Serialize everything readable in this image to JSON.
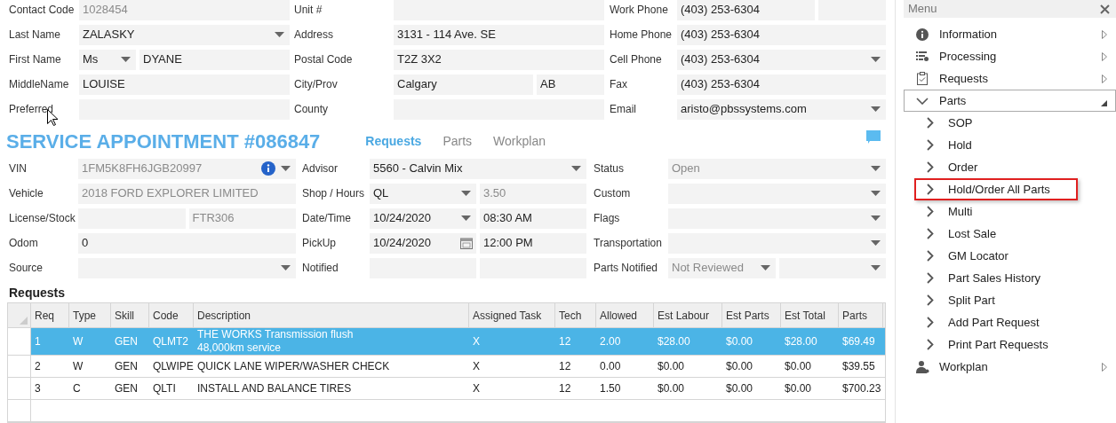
{
  "contact": {
    "columns": [
      [
        {
          "label": "Contact Code",
          "parts": [
            {
              "kind": "text",
              "value": "1028454",
              "readonly": true
            }
          ]
        },
        {
          "label": "Last Name",
          "parts": [
            {
              "kind": "dropdown",
              "value": "ZALASKY",
              "readonly": false
            }
          ]
        },
        {
          "label": "First Name",
          "parts": [
            {
              "kind": "dropdown",
              "value": "Ms",
              "readonly": false
            },
            {
              "kind": "text",
              "value": "DYANE",
              "readonly": false
            }
          ]
        },
        {
          "label": "MiddleName",
          "parts": [
            {
              "kind": "text",
              "value": "LOUISE",
              "readonly": false
            }
          ]
        },
        {
          "label": "Preferred",
          "parts": [
            {
              "kind": "text"
            }
          ]
        }
      ],
      [
        {
          "label": "Unit #",
          "parts": [
            {
              "kind": "text"
            }
          ]
        },
        {
          "label": "Address",
          "parts": [
            {
              "kind": "text",
              "value": "3131 - 114 Ave. SE",
              "readonly": false
            }
          ]
        },
        {
          "label": "Postal Code",
          "parts": [
            {
              "kind": "text",
              "value": "T2Z 3X2",
              "readonly": false
            }
          ]
        },
        {
          "label": "City/Prov",
          "parts": [
            {
              "kind": "text",
              "value": "Calgary",
              "readonly": false
            },
            {
              "kind": "text",
              "value": "AB",
              "readonly": false
            }
          ]
        },
        {
          "label": "County",
          "parts": [
            {
              "kind": "text"
            }
          ]
        }
      ],
      [
        {
          "label": "Work Phone",
          "parts": [
            {
              "kind": "text",
              "value": "(403) 253-6304",
              "readonly": false
            },
            {
              "kind": "text"
            }
          ]
        },
        {
          "label": "Home Phone",
          "parts": [
            {
              "kind": "text",
              "value": "(403) 253-6304",
              "readonly": false
            }
          ]
        },
        {
          "label": "Cell Phone",
          "parts": [
            {
              "kind": "dropdown",
              "value": "(403) 253-6304",
              "readonly": false
            }
          ]
        },
        {
          "label": "Fax",
          "parts": [
            {
              "kind": "text",
              "value": "(403) 253-6304",
              "readonly": false
            }
          ]
        },
        {
          "label": "Email",
          "parts": [
            {
              "kind": "dropdown",
              "value": "aristo@pbssystems.com",
              "readonly": false
            }
          ]
        }
      ]
    ]
  },
  "appointment": {
    "title": "SERVICE APPOINTMENT #086847",
    "tabs": [
      {
        "label": "Requests",
        "selected": true
      },
      {
        "label": "Parts",
        "selected": false
      },
      {
        "label": "Workplan",
        "selected": false
      }
    ],
    "columns": [
      [
        {
          "label": "VIN",
          "parts": [
            {
              "kind": "lookup",
              "value": "1FM5K8FH6JGB20997",
              "readonly": true
            }
          ]
        },
        {
          "label": "Vehicle",
          "parts": [
            {
              "kind": "text",
              "value": "2018 FORD EXPLORER LIMITED",
              "readonly": true
            }
          ]
        },
        {
          "label": "License/Stock",
          "parts": [
            {
              "kind": "text"
            },
            {
              "kind": "text",
              "value": "FTR306",
              "readonly": true
            }
          ]
        },
        {
          "label": "Odom",
          "parts": [
            {
              "kind": "text",
              "value": "0",
              "readonly": false
            }
          ]
        },
        {
          "label": "Source",
          "parts": [
            {
              "kind": "dropdown"
            }
          ]
        }
      ],
      [
        {
          "label": "Advisor",
          "parts": [
            {
              "kind": "dropdown",
              "value": "5560 - Calvin Mix",
              "readonly": false
            }
          ]
        },
        {
          "label": "Shop / Hours",
          "parts": [
            {
              "kind": "dropdown",
              "value": "QL",
              "readonly": false
            },
            {
              "kind": "text",
              "value": "3.50",
              "readonly": true
            }
          ]
        },
        {
          "label": "Date/Time",
          "parts": [
            {
              "kind": "dropdown",
              "value": "10/24/2020",
              "readonly": false
            },
            {
              "kind": "text",
              "value": "08:30 AM",
              "readonly": false
            }
          ]
        },
        {
          "label": "PickUp",
          "parts": [
            {
              "kind": "date",
              "value": "10/24/2020",
              "readonly": false
            },
            {
              "kind": "text",
              "value": "12:00 PM",
              "readonly": false
            }
          ]
        },
        {
          "label": "Notified",
          "parts": [
            {
              "kind": "text"
            },
            {
              "kind": "text"
            }
          ]
        }
      ],
      [
        {
          "label": "Status",
          "parts": [
            {
              "kind": "dropdown",
              "value": "Open",
              "readonly": true
            }
          ]
        },
        {
          "label": "Custom",
          "parts": [
            {
              "kind": "dropdown"
            }
          ]
        },
        {
          "label": "Flags",
          "parts": [
            {
              "kind": "dropdown"
            }
          ]
        },
        {
          "label": "Transportation",
          "parts": [
            {
              "kind": "dropdown"
            }
          ]
        },
        {
          "label": "Parts Notified",
          "parts": [
            {
              "kind": "dropdown",
              "value": "Not Reviewed",
              "readonly": true
            },
            {
              "kind": "dropdown"
            }
          ]
        }
      ]
    ]
  },
  "requests": {
    "title": "Requests",
    "columns": [
      "Req",
      "Type",
      "Skill",
      "Code",
      "Description",
      "Assigned Task",
      "Tech",
      "Allowed",
      "Est Labour",
      "Est Parts",
      "Est Total",
      "Parts"
    ],
    "rows": [
      {
        "selected": true,
        "cells": [
          "1",
          "W",
          "GEN",
          "QLMT2",
          "THE WORKS Transmission flush\n48,000km service",
          "X",
          "12",
          "2.00",
          "$28.00",
          "$0.00",
          "$28.00",
          "$69.49"
        ]
      },
      {
        "selected": false,
        "cells": [
          "2",
          "W",
          "GEN",
          "QLWIPE",
          "QUICK LANE WIPER/WASHER CHECK",
          "X",
          "12",
          "0.00",
          "$0.00",
          "$0.00",
          "$0.00",
          "$39.55"
        ]
      },
      {
        "selected": false,
        "cells": [
          "3",
          "C",
          "GEN",
          "QLTI",
          "INSTALL AND BALANCE TIRES",
          "X",
          "12",
          "1.50",
          "$0.00",
          "$0.00",
          "$0.00",
          "$700.23"
        ]
      }
    ]
  },
  "menu": {
    "title": "Menu",
    "items": [
      {
        "label": "Information",
        "expanded": false
      },
      {
        "label": "Processing",
        "expanded": false
      },
      {
        "label": "Requests",
        "expanded": false
      },
      {
        "label": "Parts",
        "expanded": true,
        "children": [
          {
            "label": "SOP",
            "highlighted": false
          },
          {
            "label": "Hold",
            "highlighted": false
          },
          {
            "label": "Order",
            "highlighted": false
          },
          {
            "label": "Hold/Order All Parts",
            "highlighted": true
          },
          {
            "label": "Multi",
            "highlighted": false
          },
          {
            "label": "Lost Sale",
            "highlighted": false
          },
          {
            "label": "GM Locator",
            "highlighted": false
          },
          {
            "label": "Part Sales History",
            "highlighted": false
          },
          {
            "label": "Split Part",
            "highlighted": false
          },
          {
            "label": "Add Part Request",
            "highlighted": false
          },
          {
            "label": "Print Part Requests",
            "highlighted": false
          }
        ]
      },
      {
        "label": "Workplan",
        "expanded": false
      }
    ]
  }
}
